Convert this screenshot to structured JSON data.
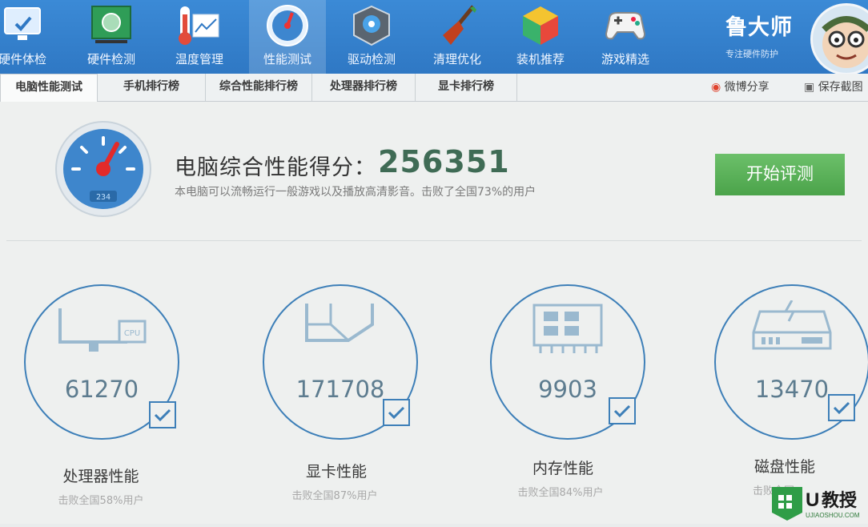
{
  "toolbar": {
    "items": [
      {
        "label": "硬件体检",
        "icon": "monitor-check-icon"
      },
      {
        "label": "硬件检测",
        "icon": "motherboard-icon"
      },
      {
        "label": "温度管理",
        "icon": "thermometer-icon"
      },
      {
        "label": "性能测试",
        "icon": "speedometer-icon"
      },
      {
        "label": "驱动检测",
        "icon": "gear-box-icon"
      },
      {
        "label": "清理优化",
        "icon": "broom-icon"
      },
      {
        "label": "装机推荐",
        "icon": "cube-icon"
      },
      {
        "label": "游戏精选",
        "icon": "gamepad-icon"
      }
    ],
    "active_index": 3
  },
  "brand": {
    "name": "鲁大师",
    "slogan": "专注硬件防护"
  },
  "tabs": [
    {
      "label": "电脑性能测试"
    },
    {
      "label": "手机排行榜"
    },
    {
      "label": "综合性能排行榜"
    },
    {
      "label": "处理器排行榜"
    },
    {
      "label": "显卡排行榜"
    }
  ],
  "share": {
    "weibo": "微博分享",
    "screenshot": "保存截图"
  },
  "score": {
    "title": "电脑综合性能得分：",
    "value": "256351",
    "description": "本电脑可以流畅运行一般游戏以及播放高清影音。击败了全国73%的用户",
    "gauge_readout": "234"
  },
  "start_button": "开始评测",
  "metrics": [
    {
      "value": "61270",
      "label": "处理器性能",
      "sub": "击败全国58%用户",
      "icon": "cpu-monitor-icon",
      "cpu_text": "CPU"
    },
    {
      "value": "171708",
      "label": "显卡性能",
      "sub": "击败全国87%用户",
      "icon": "graphics-cube-icon"
    },
    {
      "value": "9903",
      "label": "内存性能",
      "sub": "击败全国84%用户",
      "icon": "memory-chip-icon"
    },
    {
      "value": "13470",
      "label": "磁盘性能",
      "sub": "击败全国",
      "icon": "disk-drive-icon"
    }
  ],
  "watermark": {
    "letter": "U",
    "text": "教授",
    "domain": "UJIAOSHOU.COM"
  },
  "colors": {
    "toolbar": "#2f78c4",
    "score": "#3f6b55",
    "button": "#4ba34a",
    "ring": "#3d7fb8"
  }
}
